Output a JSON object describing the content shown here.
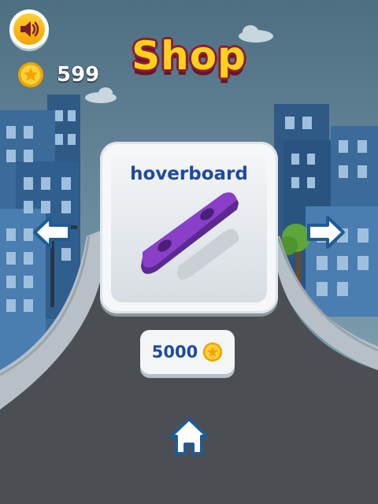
{
  "header": {
    "title": "Shop",
    "coins": "599"
  },
  "shop": {
    "item_name": "hoverboard",
    "price": "5000"
  },
  "icons": {
    "sound": "speaker-icon",
    "coin": "coin-star-icon",
    "prev": "arrow-left-icon",
    "next": "arrow-right-icon",
    "home": "home-icon",
    "item": "hoverboard-icon"
  },
  "colors": {
    "title_fill": "#ffd21a",
    "title_outline": "#8b1c3c",
    "item_text": "#1e4aa0",
    "coin_gold": "#f7b500",
    "hoverboard_purple": "#8a3fc9"
  }
}
